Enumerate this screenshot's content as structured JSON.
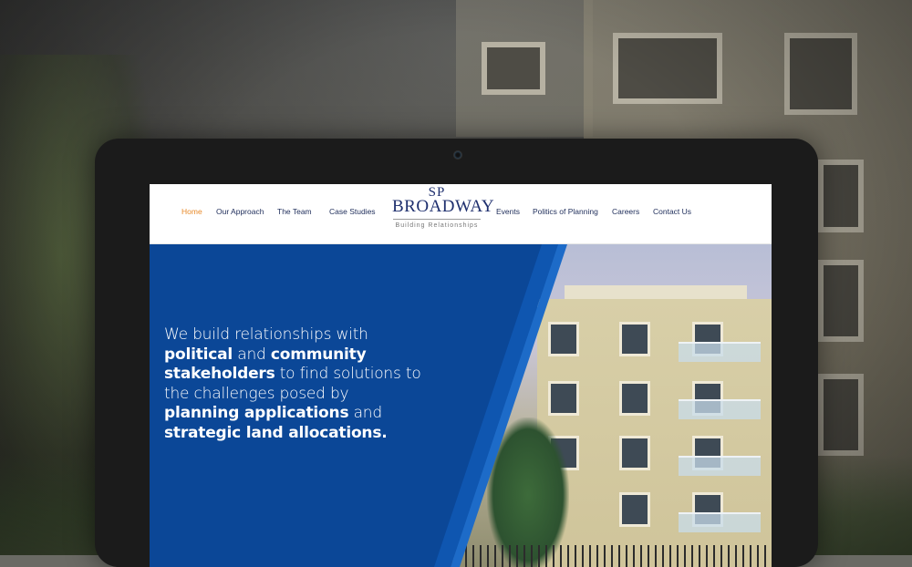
{
  "nav": {
    "left": [
      "Home",
      "Our Approach",
      "The Team",
      "Case Studies"
    ],
    "right": [
      "Events",
      "Politics of Planning",
      "Careers",
      "Contact Us"
    ],
    "active": "Home"
  },
  "logo": {
    "monogram": "SP",
    "name": "BROADWAY",
    "tagline": "Building Relationships"
  },
  "hero": {
    "line1": "We build relationships with",
    "line2_bold1": "political",
    "line2_mid": " and ",
    "line2_bold2": "community",
    "line3_bold": "stakeholders",
    "line3_rest": " to find solutions to",
    "line4": "the challenges posed by",
    "line5_bold": "planning applications",
    "line5_rest": " and",
    "line6_bold": "strategic land allocations."
  },
  "colors": {
    "accent_active": "#e88a2a",
    "nav_text": "#1e2d5a",
    "hero_blue": "#0b4797",
    "logo_blue": "#1e2f6e"
  }
}
